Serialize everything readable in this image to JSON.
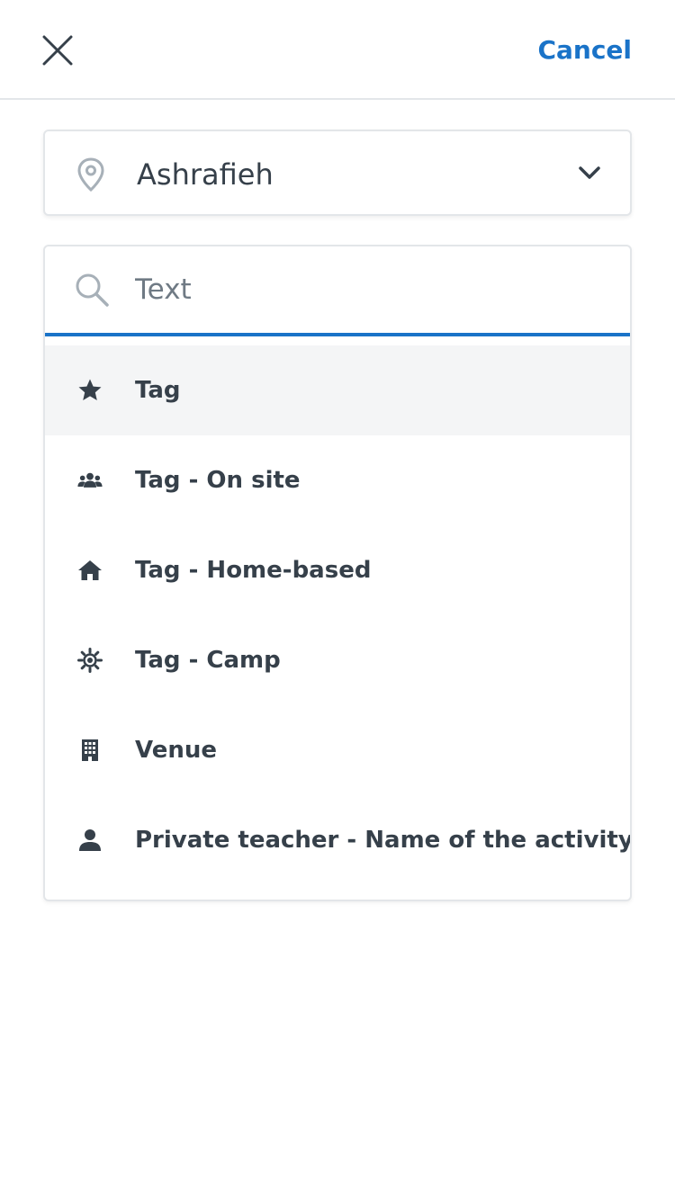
{
  "header": {
    "cancel_label": "Cancel"
  },
  "location": {
    "value": "Ashrafieh"
  },
  "search": {
    "placeholder": "Text",
    "value": ""
  },
  "results": [
    {
      "label": "Tag",
      "icon": "star-icon"
    },
    {
      "label": "Tag - On site",
      "icon": "group-icon"
    },
    {
      "label": "Tag - Home-based",
      "icon": "home-icon"
    },
    {
      "label": "Tag - Camp",
      "icon": "sun-icon"
    },
    {
      "label": "Venue",
      "icon": "building-icon"
    },
    {
      "label": "Private teacher - Name of the activity",
      "icon": "person-icon"
    }
  ],
  "colors": {
    "accent": "#1a73c8",
    "text": "#36404a",
    "border": "#e3e6e9",
    "highlight": "#f4f5f6"
  }
}
